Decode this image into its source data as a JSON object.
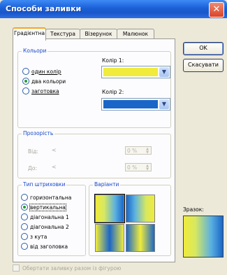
{
  "dialog": {
    "title": "Способи заливки",
    "close_glyph": "✕"
  },
  "tabs": [
    {
      "label": "Градієнтна",
      "active": true
    },
    {
      "label": "Текстура",
      "active": false
    },
    {
      "label": "Візерунок",
      "active": false
    },
    {
      "label": "Малюнок",
      "active": false
    }
  ],
  "colors_group": {
    "legend": "Кольори",
    "options": [
      {
        "label": "один колір",
        "checked": false
      },
      {
        "label": "два кольори",
        "checked": true
      },
      {
        "label": "заготовка",
        "checked": false
      }
    ],
    "color1_label": "Колір 1:",
    "color1_value": "#f0eb3c",
    "color2_label": "Колір 2:",
    "color2_value": "#1a66c8"
  },
  "transparency_group": {
    "legend": "Прозорість",
    "from_label": "Від:",
    "to_label": "До:",
    "from_value": "0 %",
    "to_value": "0 %"
  },
  "shading_group": {
    "legend": "Тип штриховки",
    "options": [
      {
        "label": "горизонтальна",
        "checked": false
      },
      {
        "label": "вертикальна",
        "checked": true
      },
      {
        "label": "діагональна 1",
        "checked": false
      },
      {
        "label": "діагональна 2",
        "checked": false
      },
      {
        "label": "з кута",
        "checked": false
      },
      {
        "label": "від заголовка",
        "checked": false
      }
    ]
  },
  "variants_group": {
    "legend": "Варіанти"
  },
  "buttons": {
    "ok": "OK",
    "cancel": "Скасувати"
  },
  "preview": {
    "label": "Зразок:"
  },
  "rotate_checkbox": {
    "label": "Обертати заливку разом із фігурою",
    "checked": false,
    "enabled": false
  }
}
